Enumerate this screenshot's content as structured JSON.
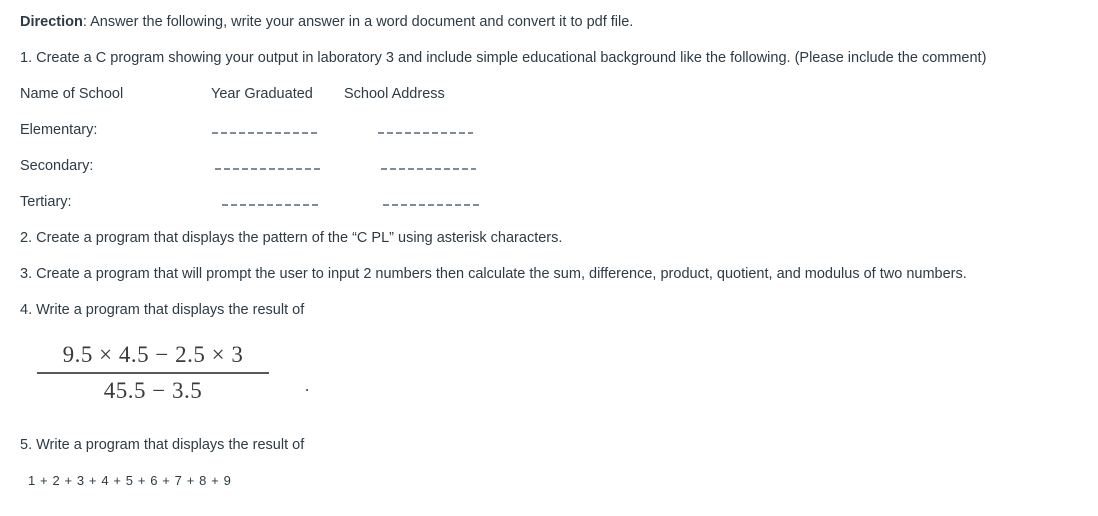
{
  "document": {
    "direction_label": "Direction",
    "direction_text": ": Answer the following, write your answer in a word document and convert it to pdf file.",
    "items": {
      "q1": "1. Create a C program showing your output in laboratory 3 and include simple educational background like the following. (Please include the comment)",
      "q2": "2. Create a program that displays the pattern of the “C PL” using asterisk characters.",
      "q3": "3. Create a program that will prompt the user to input 2 numbers then calculate the sum, difference, product, quotient, and modulus of two numbers.",
      "q4": "4. Write a program that displays the result of",
      "q5": "5. Write a program that displays the result of"
    },
    "table": {
      "headers": {
        "col1": "Name of School",
        "col2": "Year Graduated",
        "col3": "School Address"
      },
      "rows": [
        {
          "label": "Elementary:",
          "year_blank": "",
          "address_blank": ""
        },
        {
          "label": "Secondary:",
          "year_blank": "",
          "address_blank": ""
        },
        {
          "label": "Tertiary:",
          "year_blank": "",
          "address_blank": ""
        }
      ]
    },
    "formula": {
      "numerator": "9.5 × 4.5 − 2.5 × 3",
      "denominator": "45.5 − 3.5",
      "trailing_punctuation": "."
    },
    "sum_expression": "1 + 2 + 3 + 4 + 5 + 6 + 7 + 8 + 9",
    "colors": {
      "text": "#2d3b45",
      "formula_text": "#3a3a3a",
      "blank_line": "#7f8c9b",
      "background": "#ffffff"
    }
  }
}
